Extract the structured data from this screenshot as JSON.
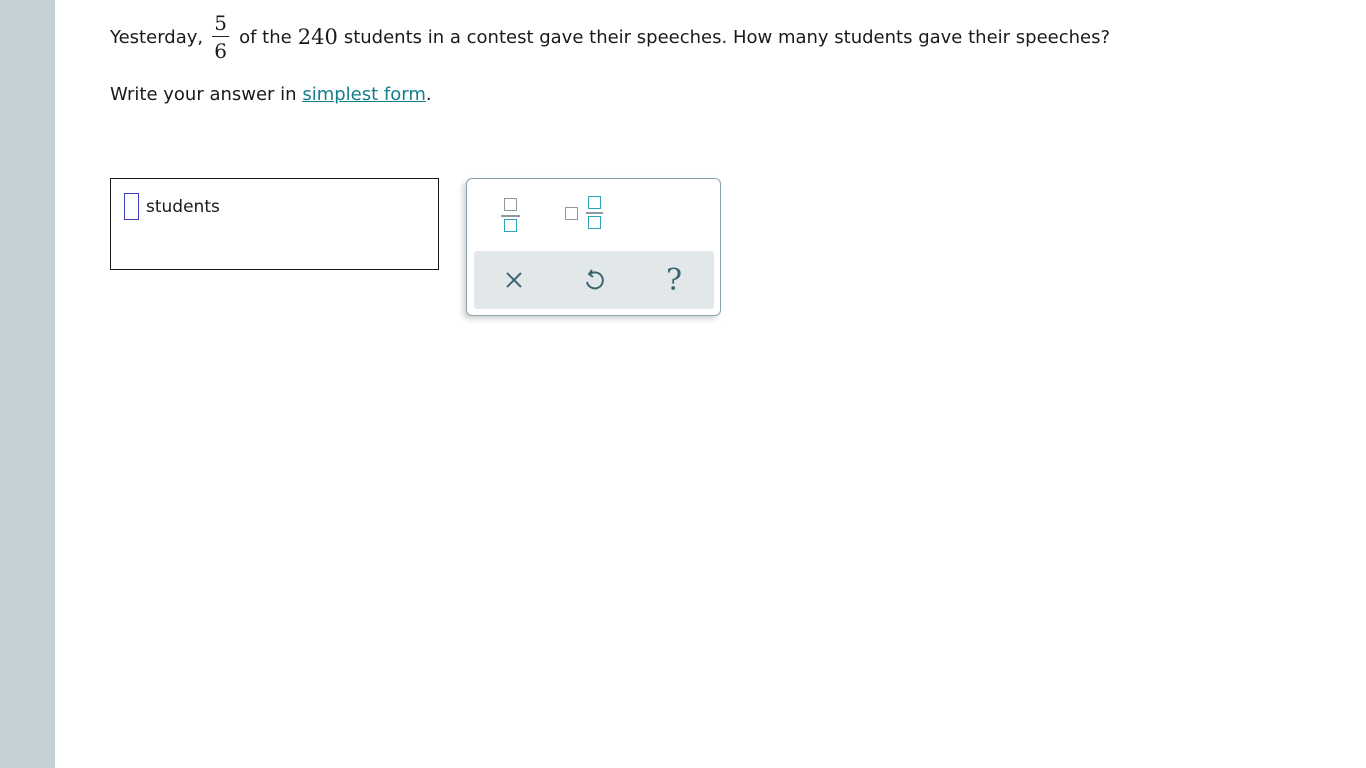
{
  "question": {
    "prefix": "Yesterday,",
    "fraction": {
      "numerator": "5",
      "denominator": "6"
    },
    "middle": "of the",
    "total": "240",
    "suffix": "students in a contest gave their speeches. How many students gave their speeches?"
  },
  "instruction": {
    "prefix": "Write your answer in",
    "link": "simplest form",
    "suffix": "."
  },
  "answer": {
    "value": "",
    "unit": "students"
  },
  "palette": {
    "tools": [
      {
        "icon": "fraction-template-icon"
      },
      {
        "icon": "mixed-number-template-icon"
      }
    ],
    "actions": [
      {
        "icon": "clear-icon",
        "glyph": "×"
      },
      {
        "icon": "undo-icon",
        "glyph": "↺"
      },
      {
        "icon": "help-icon",
        "glyph": "?"
      }
    ]
  },
  "colors": {
    "rail": "#c3d0d4",
    "link": "#137e8c",
    "cursor": "#3f3fbf",
    "teal": "#2aa6b8",
    "action_bar": "#e2e8ea"
  }
}
